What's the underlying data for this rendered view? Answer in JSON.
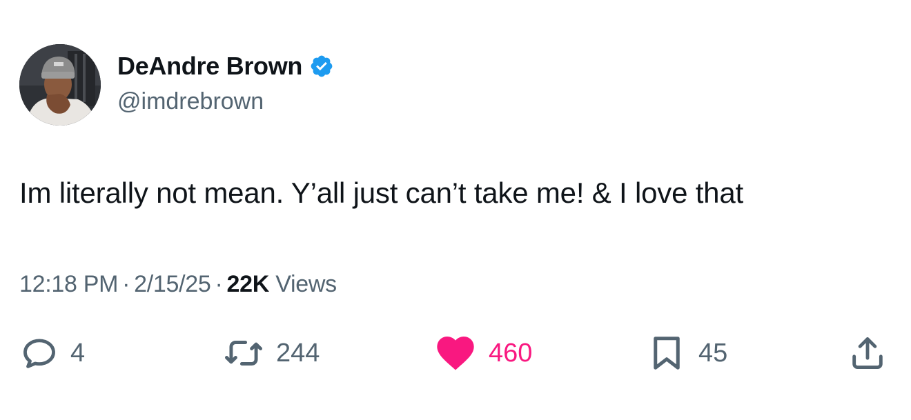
{
  "author": {
    "display_name": "DeAndre Brown",
    "handle": "@imdrebrown",
    "verified": true,
    "verified_color": "#1d9bf0"
  },
  "tweet": {
    "text": "Im literally not mean. Y’all just can’t take me! & I love that",
    "time": "12:18 PM",
    "date": "2/15/25",
    "separator": "·",
    "views_count": "22K",
    "views_label": "Views"
  },
  "actions": {
    "reply": {
      "icon": "reply-icon",
      "count": "4"
    },
    "retweet": {
      "icon": "retweet-icon",
      "count": "244"
    },
    "like": {
      "icon": "heart-icon",
      "count": "460",
      "color": "#f91880",
      "liked": true
    },
    "bookmark": {
      "icon": "bookmark-icon",
      "count": "45"
    },
    "share": {
      "icon": "share-icon"
    }
  },
  "colors": {
    "text_primary": "#0f1419",
    "text_secondary": "#536471",
    "accent": "#1d9bf0",
    "like": "#f91880"
  }
}
